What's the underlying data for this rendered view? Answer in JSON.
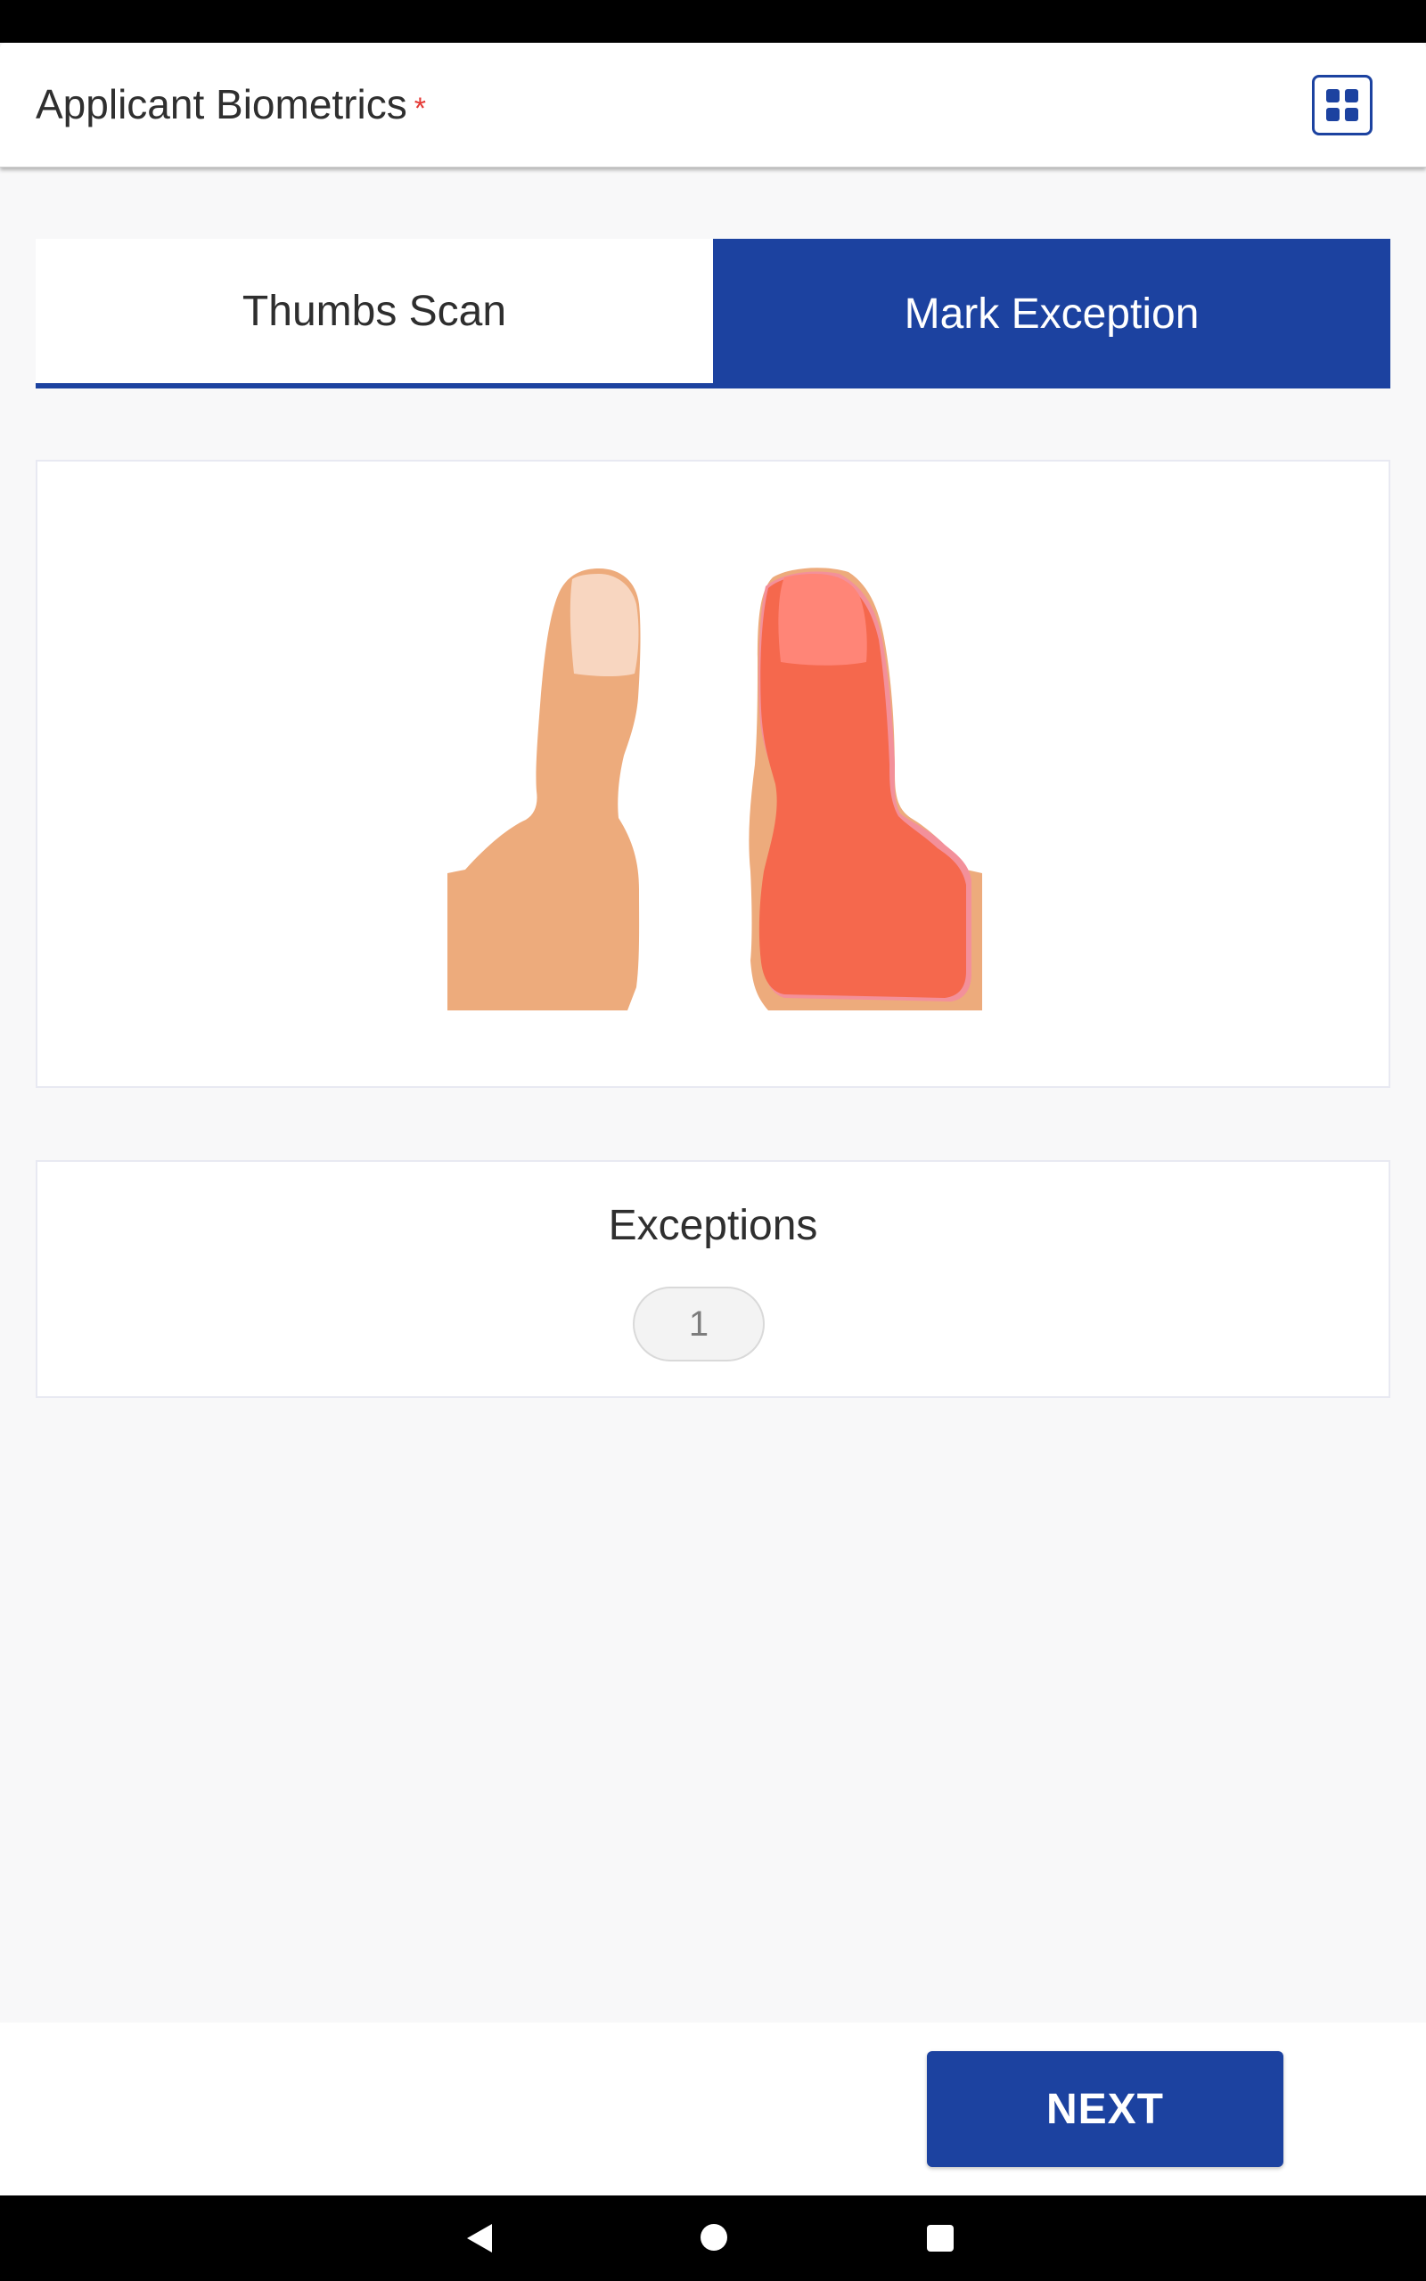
{
  "header": {
    "title": "Applicant Biometrics",
    "required_marker": "*",
    "grid_icon": "grid-icon"
  },
  "tabs": [
    {
      "label": "Thumbs Scan",
      "selected": false
    },
    {
      "label": "Mark Exception",
      "selected": true
    }
  ],
  "thumbs": {
    "left_thumb": "normal",
    "right_thumb": "exception-marked",
    "colors": {
      "skin": "#edab7c",
      "nail": "#f8d6c0",
      "exception_overlay": "#f5684d",
      "exception_nail": "#ff8577",
      "exception_outline": "#f3909a"
    }
  },
  "exceptions": {
    "title": "Exceptions",
    "count": "1"
  },
  "footer": {
    "next_label": "NEXT"
  },
  "navigation": {
    "back_icon": "back-icon",
    "home_icon": "home-icon",
    "recent_icon": "recent-apps-icon"
  },
  "colors": {
    "accent": "#1c42a0",
    "required": "#e53935",
    "background": "#f8f8f9"
  }
}
